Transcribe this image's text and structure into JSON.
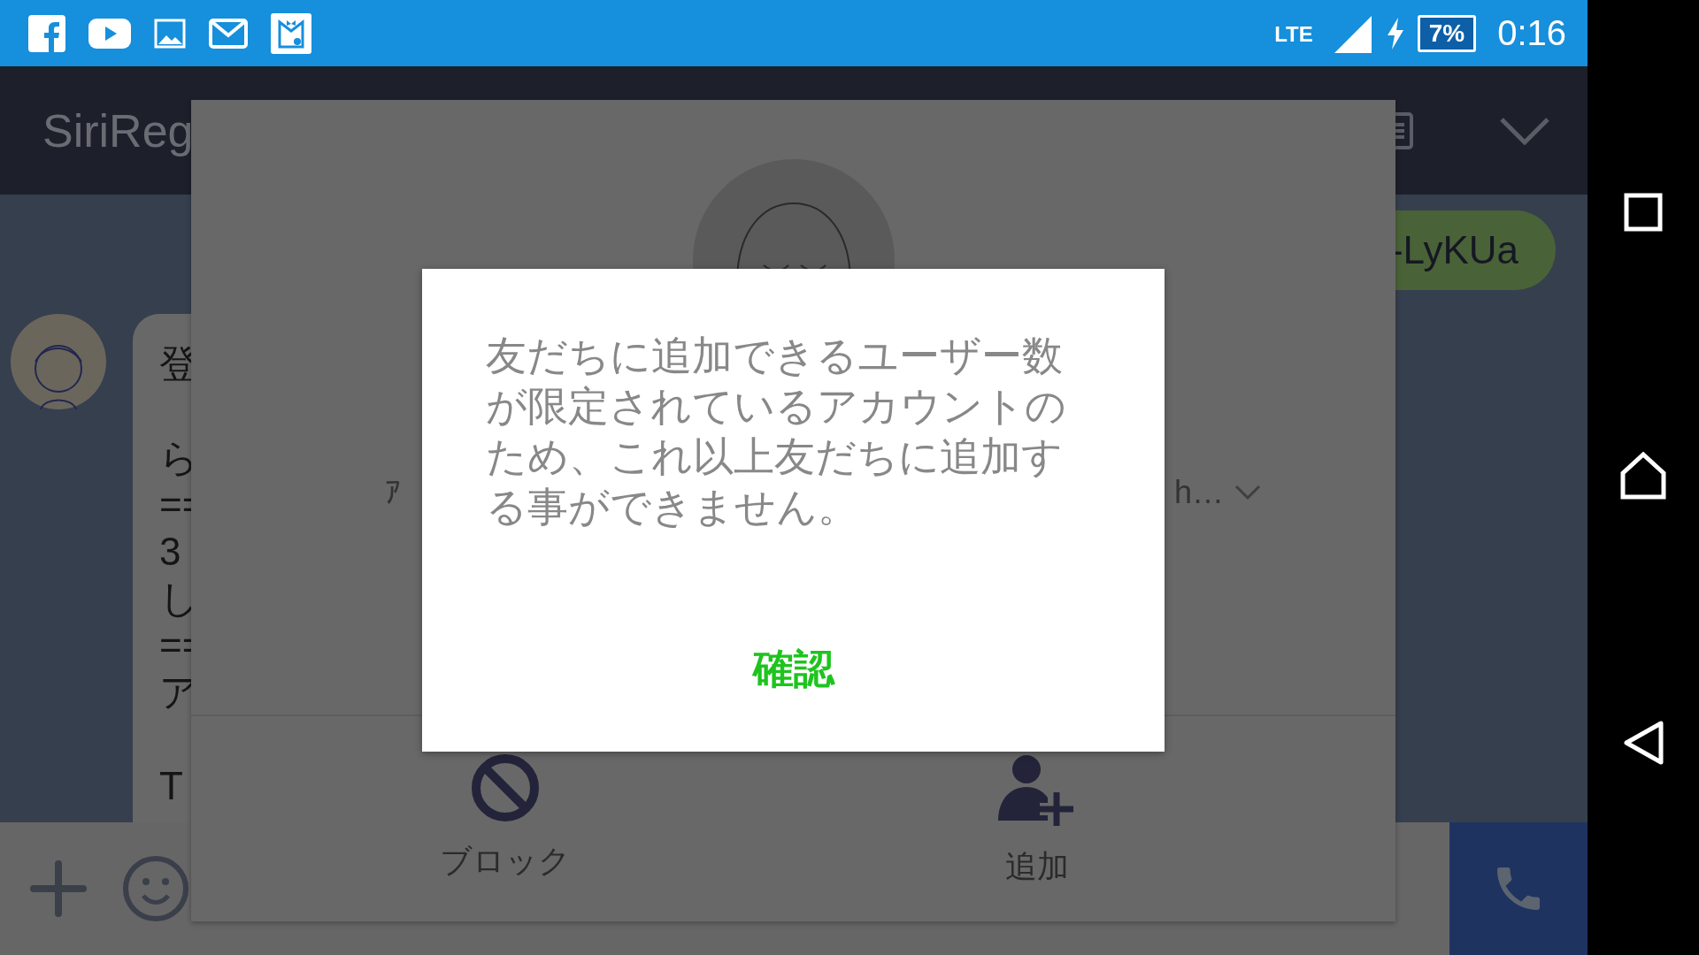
{
  "status_bar": {
    "network": "LTE",
    "battery": "7%",
    "time": "0:16"
  },
  "header": {
    "title": "SiriReg"
  },
  "chat": {
    "received": {
      "paragraphs": [
        [
          "登"
        ],
        [
          "ら",
          "==",
          "3",
          "し",
          "==",
          "ア"
        ],
        [
          "T"
        ]
      ]
    },
    "sent": {
      "text": "-LyKUa"
    }
  },
  "profile_sheet": {
    "field_left": "ｱ",
    "field_right": "h…",
    "actions": [
      {
        "kind": "block",
        "label": "ブロック"
      },
      {
        "kind": "add",
        "label": "追加"
      }
    ]
  },
  "dialog": {
    "message": "友だちに追加できるユーザー数が限定されているアカウントのため、これ以上友だちに追加する事ができません。",
    "button": "確認"
  }
}
